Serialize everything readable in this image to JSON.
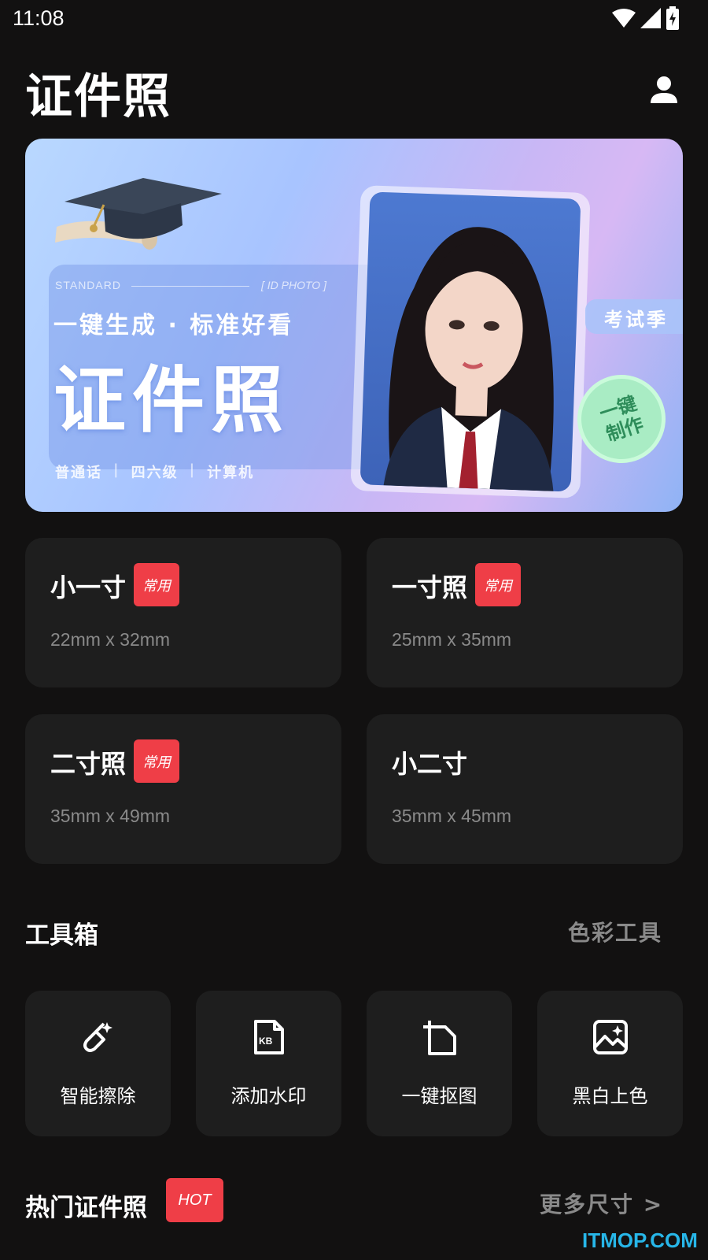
{
  "status_bar": {
    "time": "11:08",
    "icons": [
      "wifi-icon",
      "signal-icon",
      "battery-charging-icon"
    ]
  },
  "header": {
    "title": "证件照",
    "profile_icon": "person-icon"
  },
  "banner": {
    "tag_left": "STANDARD",
    "tag_right": "[ ID PHOTO ]",
    "subtitle": "一键生成 · 标准好看",
    "main_text": "证件照",
    "tags": [
      "普通话",
      "四六级",
      "计算机"
    ],
    "badge_season": "考试季",
    "badge_circle_line1": "一键",
    "badge_circle_line2": "制作"
  },
  "size_cards": [
    {
      "name": "小一寸",
      "tag": "常用",
      "dims": "22mm x 32mm"
    },
    {
      "name": "一寸照",
      "tag": "常用",
      "dims": "25mm x 35mm"
    },
    {
      "name": "二寸照",
      "tag": "常用",
      "dims": "35mm x 49mm"
    },
    {
      "name": "小二寸",
      "tag": "",
      "dims": "35mm x 45mm"
    }
  ],
  "toolbox": {
    "title": "工具箱",
    "link": "色彩工具",
    "tools": [
      {
        "label": "智能擦除",
        "icon": "magic-eraser-icon"
      },
      {
        "label": "添加水印",
        "icon": "kb-file-icon"
      },
      {
        "label": "一键抠图",
        "icon": "crop-icon"
      },
      {
        "label": "黑白上色",
        "icon": "image-icon"
      }
    ]
  },
  "hot": {
    "title": "热门证件照",
    "badge": "HOT",
    "link": "更多尺寸 >"
  },
  "watermark": "ITMOP.COM",
  "colors": {
    "background": "#121111",
    "card": "#1e1e1e",
    "accent_red": "#ef3e47",
    "muted_text": "#8a8a8a"
  }
}
